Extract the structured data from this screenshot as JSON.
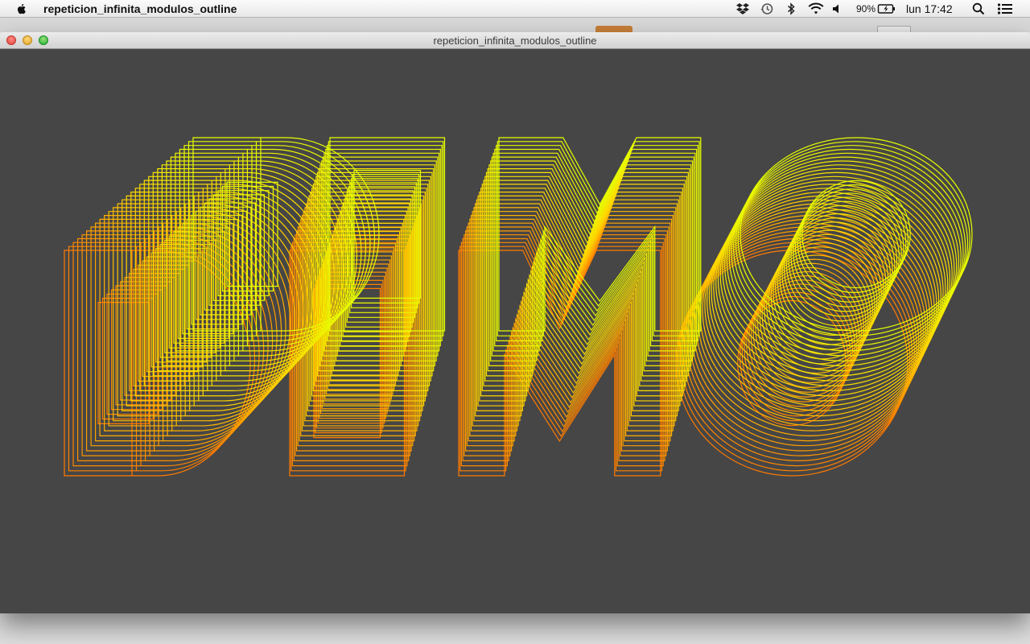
{
  "menubar": {
    "app_name": "repeticion_infinita_modulos_outline",
    "battery_percent": "90%",
    "clock": "lun 17:42",
    "icons": [
      "apple-icon",
      "dropbox-icon",
      "time-machine-icon",
      "bluetooth-icon",
      "wifi-icon",
      "volume-icon",
      "battery-icon",
      "spotlight-icon",
      "notification-center-icon"
    ]
  },
  "window": {
    "title": "repeticion_infinita_modulos_outline"
  },
  "canvas": {
    "background": "#464646",
    "front_color": "#ff7a00",
    "back_color": "#e6ff00",
    "mid_color": "#ffd400"
  }
}
